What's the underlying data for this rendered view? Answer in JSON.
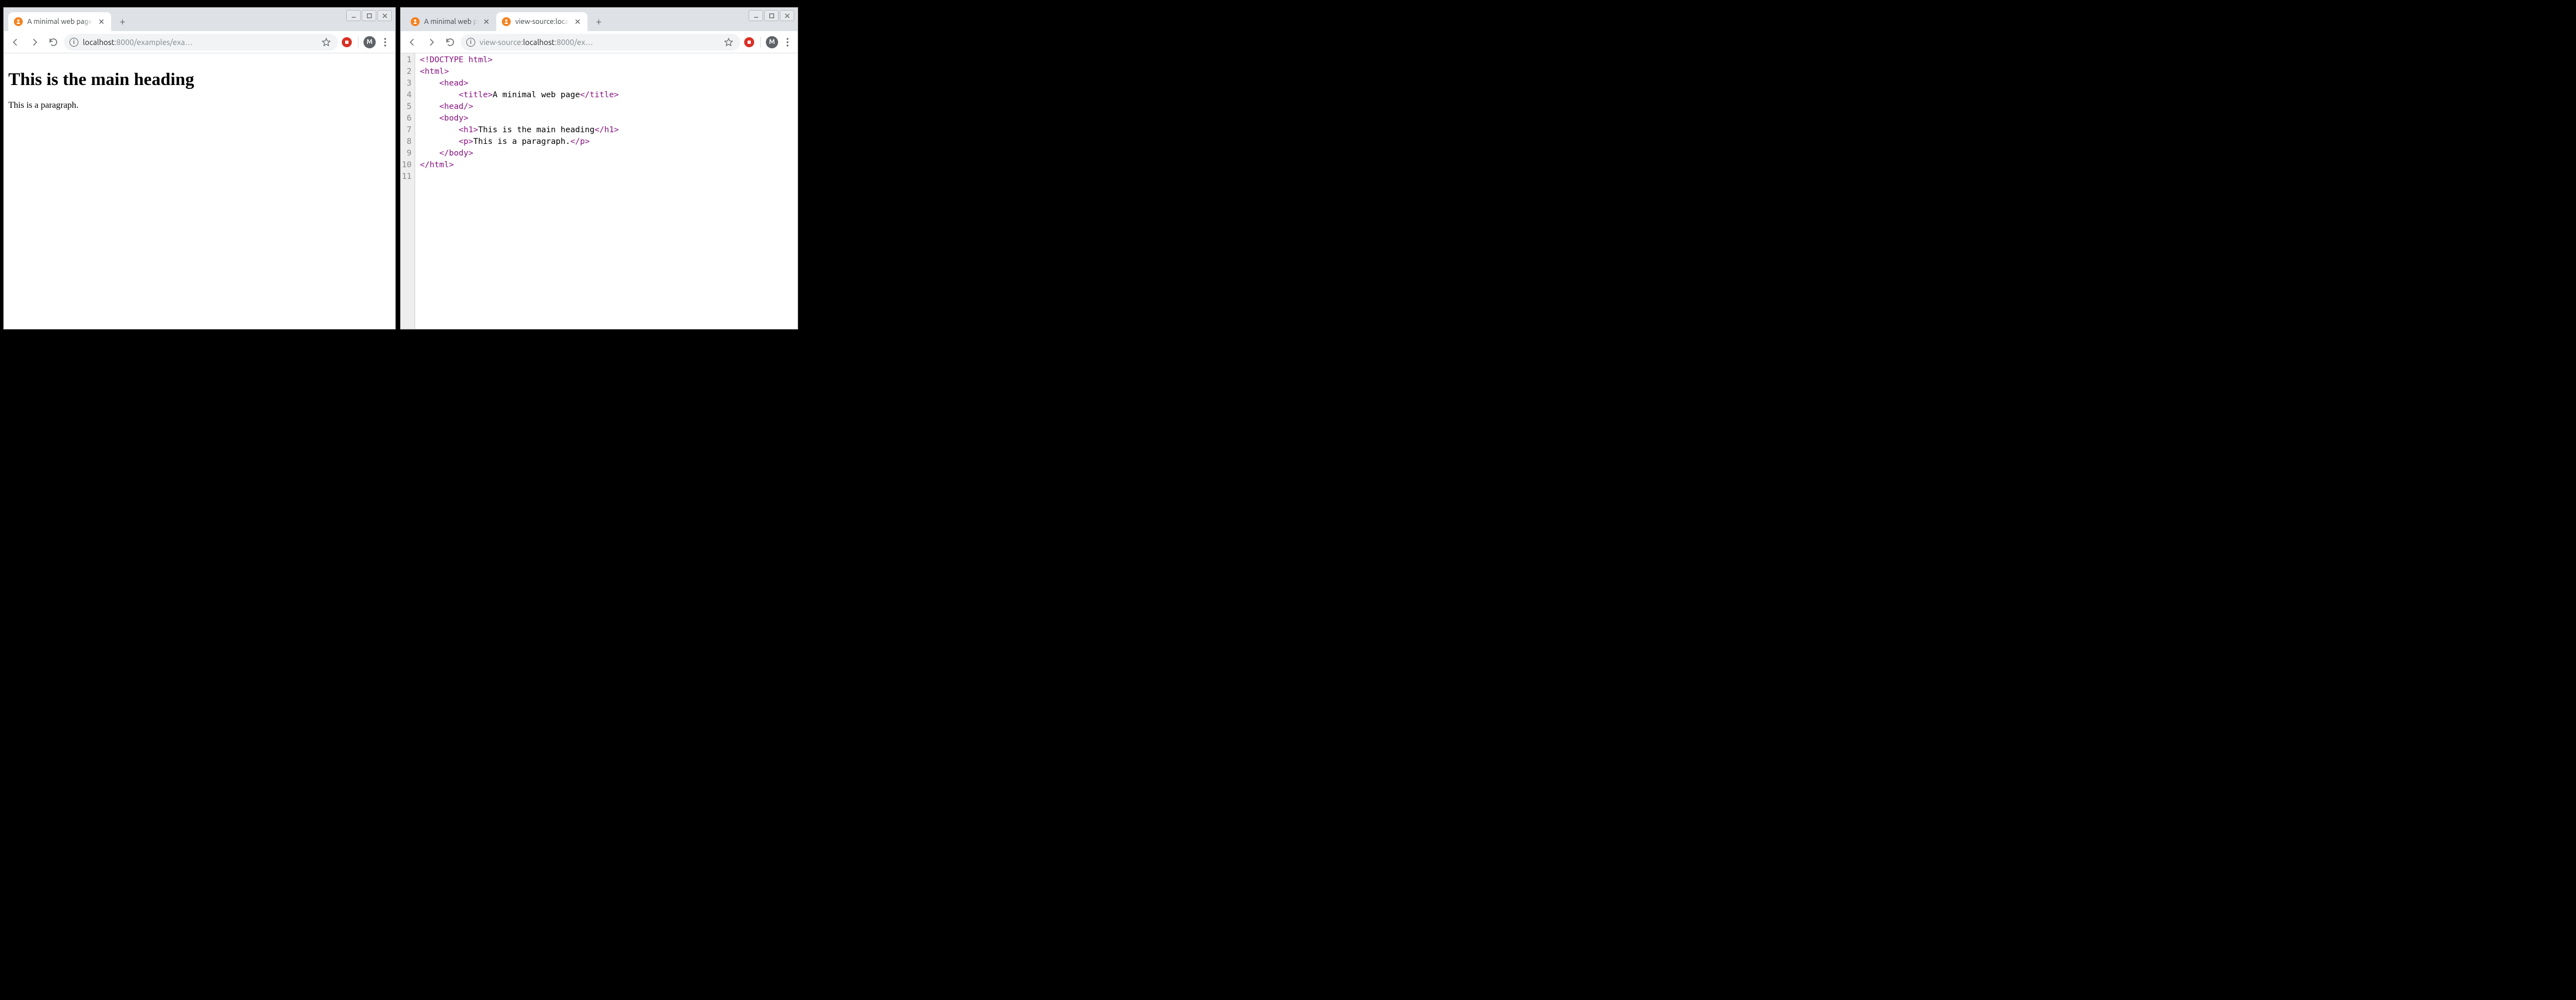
{
  "left_window": {
    "tabs": [
      {
        "title": "A minimal web page",
        "active": true
      }
    ],
    "url_dim_prefix": "localhost",
    "url_dim_port": ":8000",
    "url_rest": "/examples/exa…",
    "profile_initial": "M",
    "page": {
      "heading": "This is the main heading",
      "paragraph": "This is a paragraph."
    }
  },
  "right_window": {
    "tabs": [
      {
        "title": "A minimal web p",
        "active": false
      },
      {
        "title": "view-source:loca",
        "active": true
      }
    ],
    "url_vs_prefix": "view-source:",
    "url_host": "localhost",
    "url_rest": ":8000/ex…",
    "profile_initial": "M",
    "source": {
      "line_numbers": [
        "1",
        "2",
        "3",
        "4",
        "5",
        "6",
        "7",
        "8",
        "9",
        "10",
        "11"
      ],
      "lines": [
        {
          "indent": "",
          "pre": "<!DOCTYPE html>",
          "txt": "",
          "post": ""
        },
        {
          "indent": "",
          "pre": "<html>",
          "txt": "",
          "post": ""
        },
        {
          "indent": "    ",
          "pre": "<head>",
          "txt": "",
          "post": ""
        },
        {
          "indent": "        ",
          "pre": "<title>",
          "txt": "A minimal web page",
          "post": "</title>"
        },
        {
          "indent": "    ",
          "pre": "<head/>",
          "txt": "",
          "post": ""
        },
        {
          "indent": "    ",
          "pre": "<body>",
          "txt": "",
          "post": ""
        },
        {
          "indent": "        ",
          "pre": "<h1>",
          "txt": "This is the main heading",
          "post": "</h1>"
        },
        {
          "indent": "        ",
          "pre": "<p>",
          "txt": "This is a paragraph.",
          "post": "</p>"
        },
        {
          "indent": "    ",
          "pre": "</body>",
          "txt": "",
          "post": ""
        },
        {
          "indent": "",
          "pre": "</html>",
          "txt": "",
          "post": ""
        },
        {
          "indent": "",
          "pre": "",
          "txt": "",
          "post": ""
        }
      ]
    }
  }
}
